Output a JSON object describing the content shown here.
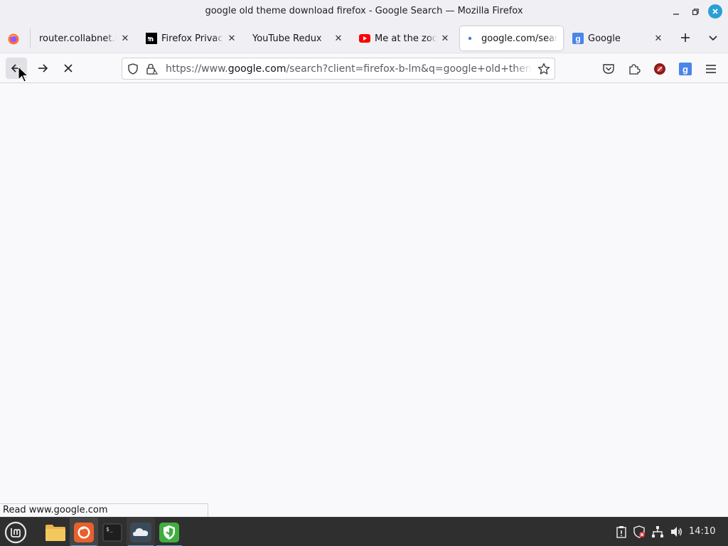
{
  "window": {
    "title": "google old theme download firefox - Google Search — Mozilla Firefox"
  },
  "tabs": [
    {
      "label": "router.collabnet.local",
      "favicon": "blank",
      "active": false
    },
    {
      "label": "Firefox Privacy Notice",
      "favicon": "mozilla-m-icon",
      "active": false
    },
    {
      "label": "YouTube Redux",
      "favicon": "blank",
      "active": false
    },
    {
      "label": "Me at the zoo - YouTube",
      "favicon": "youtube-icon",
      "active": false
    },
    {
      "label": "google.com/search",
      "favicon": "loading-dot",
      "active": true
    },
    {
      "label": "Google",
      "favicon": "google-g-icon",
      "active": false
    }
  ],
  "urlbar": {
    "prefix": "https://www.",
    "domain": "google.com",
    "rest": "/search?client=firefox-b-lm&q=google+old+theme+download+firefox"
  },
  "status": {
    "text": "Read www.google.com"
  },
  "taskbar": {
    "clock": "14:10",
    "apps": [
      "mint-menu-icon",
      "files-icon",
      "firefox-icon",
      "terminal-icon",
      "cloud-icon",
      "shield-icon"
    ]
  },
  "colors": {
    "accent": "#2a9fd6",
    "taskbar_bg": "#2f2f2f",
    "chrome_bg": "#f0f0f4"
  }
}
